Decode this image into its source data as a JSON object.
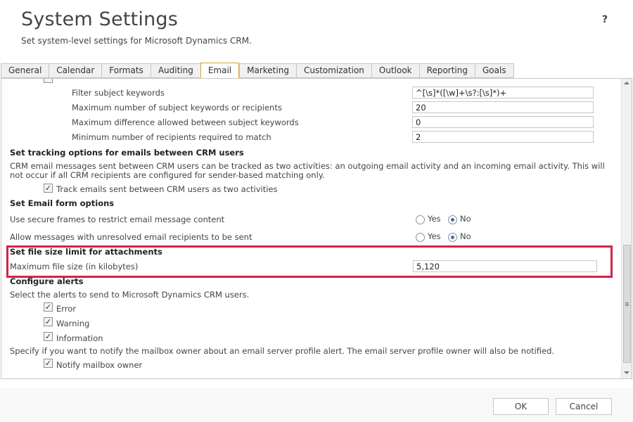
{
  "header": {
    "title": "System Settings",
    "subtitle": "Set system-level settings for Microsoft Dynamics CRM.",
    "help": "?"
  },
  "tabs": [
    {
      "label": "General"
    },
    {
      "label": "Calendar"
    },
    {
      "label": "Formats"
    },
    {
      "label": "Auditing"
    },
    {
      "label": "Email",
      "active": true
    },
    {
      "label": "Marketing"
    },
    {
      "label": "Customization"
    },
    {
      "label": "Outlook"
    },
    {
      "label": "Reporting"
    },
    {
      "label": "Goals"
    }
  ],
  "smart_matching": {
    "filter_label": "Filter subject keywords",
    "filter_value": "^[\\s]*([\\w]+\\s?:[\\s]*)+",
    "max_keywords_label": "Maximum number of subject keywords or recipients",
    "max_keywords_value": "20",
    "max_diff_label": "Maximum difference allowed between subject keywords",
    "max_diff_value": "0",
    "min_recipients_label": "Minimum number of recipients required to match",
    "min_recipients_value": "2"
  },
  "tracking": {
    "heading": "Set tracking options for emails between CRM users",
    "description": "CRM email messages sent between CRM users can be tracked as two activities: an outgoing email activity and an incoming email activity. This will not occur if all CRM recipients are configured for sender-based matching only.",
    "track_label": "Track emails sent between CRM users as two activities",
    "track_checked": true
  },
  "email_form": {
    "heading": "Set Email form options",
    "secure_frames_label": "Use secure frames to restrict email message content",
    "unresolved_label": "Allow messages with unresolved email recipients to be sent",
    "yes_label": "Yes",
    "no_label": "No",
    "secure_frames_value": "No",
    "unresolved_value": "No"
  },
  "file_size": {
    "heading": "Set file size limit for attachments",
    "max_label": "Maximum file size (in kilobytes)",
    "max_value": "5,120"
  },
  "alerts": {
    "heading": "Configure alerts",
    "description": "Select the alerts to send to Microsoft Dynamics CRM users.",
    "error_label": "Error",
    "warning_label": "Warning",
    "information_label": "Information",
    "notify_description": "Specify if you want to notify the mailbox owner about an email server profile alert. The email server profile owner will also be notified.",
    "notify_label": "Notify mailbox owner"
  },
  "footer": {
    "ok_label": "OK",
    "cancel_label": "Cancel"
  },
  "colors": {
    "highlight": "#d4224a",
    "active_tab_border": "#d7a23d"
  }
}
